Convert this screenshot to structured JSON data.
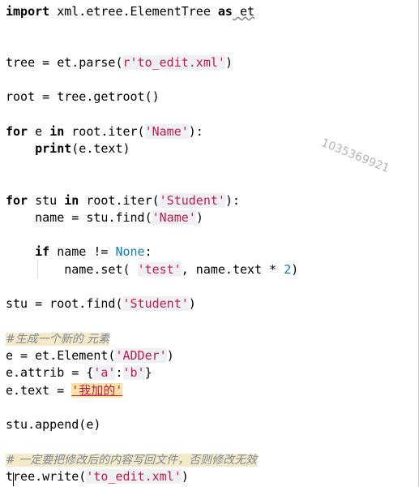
{
  "code": {
    "l1": {
      "kw": "import",
      "rest": " xml.etree.ElementTree ",
      "as": "as",
      "alias": " et"
    },
    "l2": {
      "pre": "tree = et.parse(",
      "str": "r'to_edit.xml'",
      "post": ")"
    },
    "l3": "root = tree.getroot()",
    "l4": {
      "for": "for",
      "mid": " e ",
      "in": "in",
      "pre": " root.iter(",
      "str": "'Name'",
      "post": "):"
    },
    "l5": {
      "indent": "    ",
      "print": "print",
      "post": "(e.text)"
    },
    "l6": {
      "for": "for",
      "mid": " stu ",
      "in": "in",
      "pre": " root.iter(",
      "str": "'Student'",
      "post": "):"
    },
    "l7": {
      "pre": "    name = stu.find(",
      "str": "'Name'",
      "post": ")"
    },
    "l8": {
      "indent": "    ",
      "if": "if",
      "mid": " name != ",
      "none": "None",
      "post": ":"
    },
    "l9": {
      "pre": "        name.set( ",
      "str": "'test'",
      "mid": ", name.text * ",
      "num": "2",
      "post": ")"
    },
    "l10": {
      "pre": "stu = root.find(",
      "str": "'Student'",
      "post": ")"
    },
    "l11": "#生成一个新的 元素",
    "l12": {
      "pre": "e = et.Element(",
      "str": "'ADDer'",
      "post": ")"
    },
    "l13": {
      "pre": "e.attrib = {",
      "s1": "'a'",
      "colon": ":",
      "s2": "'b'",
      "post": "}"
    },
    "l14": {
      "pre": "e.text = ",
      "str": "'我加的'"
    },
    "l15": "stu.append(e)",
    "l16": "# 一定要把修改后的内容写回文件，否则修改无效",
    "l17": {
      "pre": "tree.write(",
      "str": "'to_edit.xml'",
      "post": ")"
    }
  },
  "watermark": "1035369921"
}
